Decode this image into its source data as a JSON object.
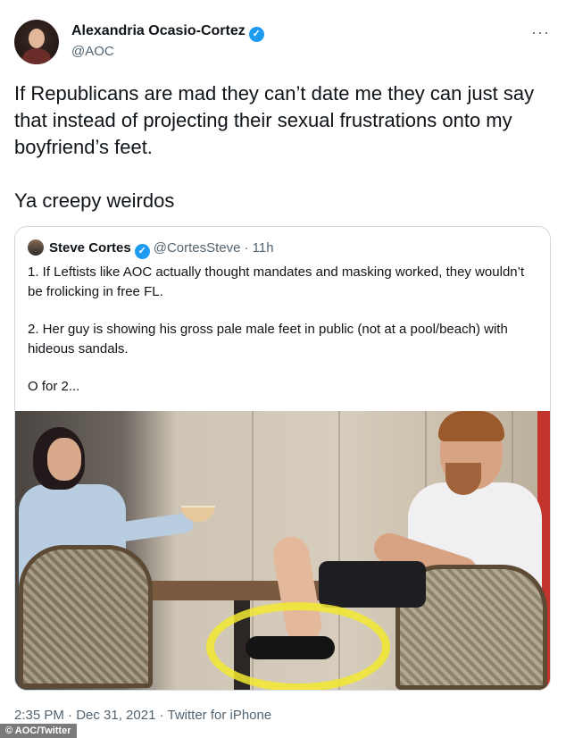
{
  "author": {
    "name": "Alexandria Ocasio-Cortez",
    "handle": "@AOC",
    "verified_icon": "verified-badge-icon",
    "more_label": "···"
  },
  "tweet": {
    "paragraph1": "If Republicans are mad they can’t date me they can just say that instead of projecting their sexual frustrations onto my boyfriend’s feet.",
    "paragraph2": "Ya creepy weirdos"
  },
  "quote": {
    "name": "Steve Cortes",
    "handle": "@CortesSteve",
    "time": "· 11h",
    "paragraph1": "1. If Leftists like AOC actually thought mandates and masking worked, they wouldn’t be frolicking in free FL.",
    "paragraph2": "2. Her guy is showing his gross pale male feet in public (not at a pool/beach) with hideous sandals.",
    "paragraph3": "O for 2..."
  },
  "footer": {
    "timestamp": "2:35 PM · Dec 31, 2021 · ",
    "source": "Twitter for iPhone"
  },
  "credit": "© AOC/Twitter",
  "colors": {
    "verified": "#1d9bf0",
    "secondary_text": "#536471",
    "border": "#cfd9de",
    "highlight_ring": "#f2e930"
  }
}
